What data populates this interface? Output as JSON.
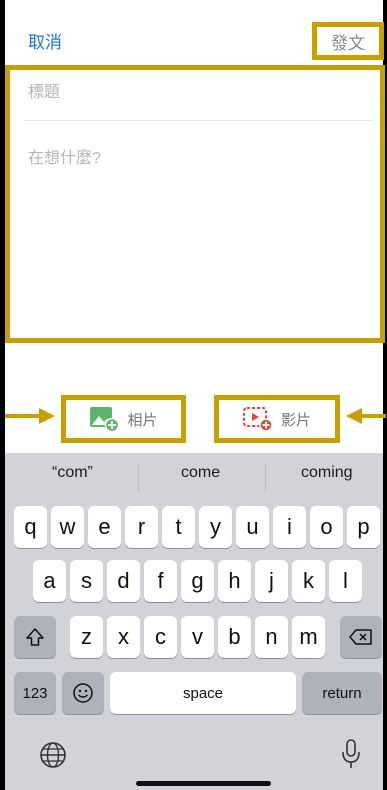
{
  "header": {
    "cancel_label": "取消",
    "post_label": "發文"
  },
  "compose": {
    "title_placeholder": "標題",
    "body_placeholder": "在想什麼?"
  },
  "media": {
    "photo_label": "相片",
    "video_label": "影片"
  },
  "keyboard": {
    "suggestions": [
      "“com”",
      "come",
      "coming"
    ],
    "row1": [
      "q",
      "w",
      "e",
      "r",
      "t",
      "y",
      "u",
      "i",
      "o",
      "p"
    ],
    "row2": [
      "a",
      "s",
      "d",
      "f",
      "g",
      "h",
      "j",
      "k",
      "l"
    ],
    "row3": [
      "z",
      "x",
      "c",
      "v",
      "b",
      "n",
      "m"
    ],
    "numbers_key": "123",
    "space_key": "space",
    "return_key": "return"
  },
  "colors": {
    "highlight": "#c7a000",
    "accent": "#1a73e8"
  }
}
